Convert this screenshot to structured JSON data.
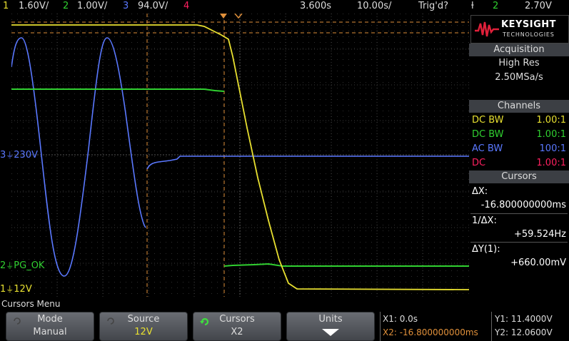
{
  "topbar": {
    "ch1": {
      "num": "1",
      "scale": "1.60V/",
      "color": "#e8e030"
    },
    "ch2": {
      "num": "2",
      "scale": "1.00V/",
      "color": "#30d030"
    },
    "ch3": {
      "num": "3",
      "scale": "94.0V/",
      "color": "#5a78ff"
    },
    "ch4": {
      "num": "4",
      "color": "#ff2060"
    },
    "time_offset": "3.600s",
    "time_scale": "10.00s/",
    "trigger_status": "Trig'd?",
    "trigger_slope": "ƚ",
    "trigger_channel": "2",
    "trigger_level": "2.70V"
  },
  "logo": {
    "brand": "KEYSIGHT",
    "sub": "TECHNOLOGIES"
  },
  "panel": {
    "acquisition": {
      "title": "Acquisition",
      "mode": "High Res",
      "rate": "2.50MSa/s"
    },
    "channels": {
      "title": "Channels",
      "items": [
        {
          "coupling": "DC BW",
          "probe": "1.00:1",
          "color": "#e8e030"
        },
        {
          "coupling": "DC BW",
          "probe": "1.00:1",
          "color": "#30d030"
        },
        {
          "coupling": "AC BW",
          "probe": "100:1",
          "color": "#5a78ff"
        },
        {
          "coupling": "DC",
          "probe": "1.00:1",
          "color": "#ff2060"
        }
      ]
    },
    "cursors": {
      "title": "Cursors",
      "dx_label": "ΔX:",
      "dx_value": "-16.800000000ms",
      "inv_dx_label": "1/ΔX:",
      "inv_dx_value": "+59.524Hz",
      "dy_label": "ΔY(1):",
      "dy_value": "+660.00mV"
    }
  },
  "screen_labels": {
    "ch3": {
      "num": "3",
      "text": "230V"
    },
    "ch2": {
      "num": "2",
      "text": "PG_OK"
    },
    "ch1": {
      "num": "1",
      "text": "12V"
    }
  },
  "menu": {
    "title": "Cursors Menu",
    "softkeys": [
      {
        "label": "Mode",
        "value": "Manual"
      },
      {
        "label": "Source",
        "value": "12V"
      },
      {
        "label": "Cursors",
        "value": "X2"
      },
      {
        "label": "Units",
        "value": ""
      }
    ]
  },
  "readout": {
    "x1": "X1: 0.0s",
    "x2": "X2: -16.800000000ms",
    "y1": "Y1: 11.4000V",
    "y2": "Y2: 12.0600V"
  }
}
